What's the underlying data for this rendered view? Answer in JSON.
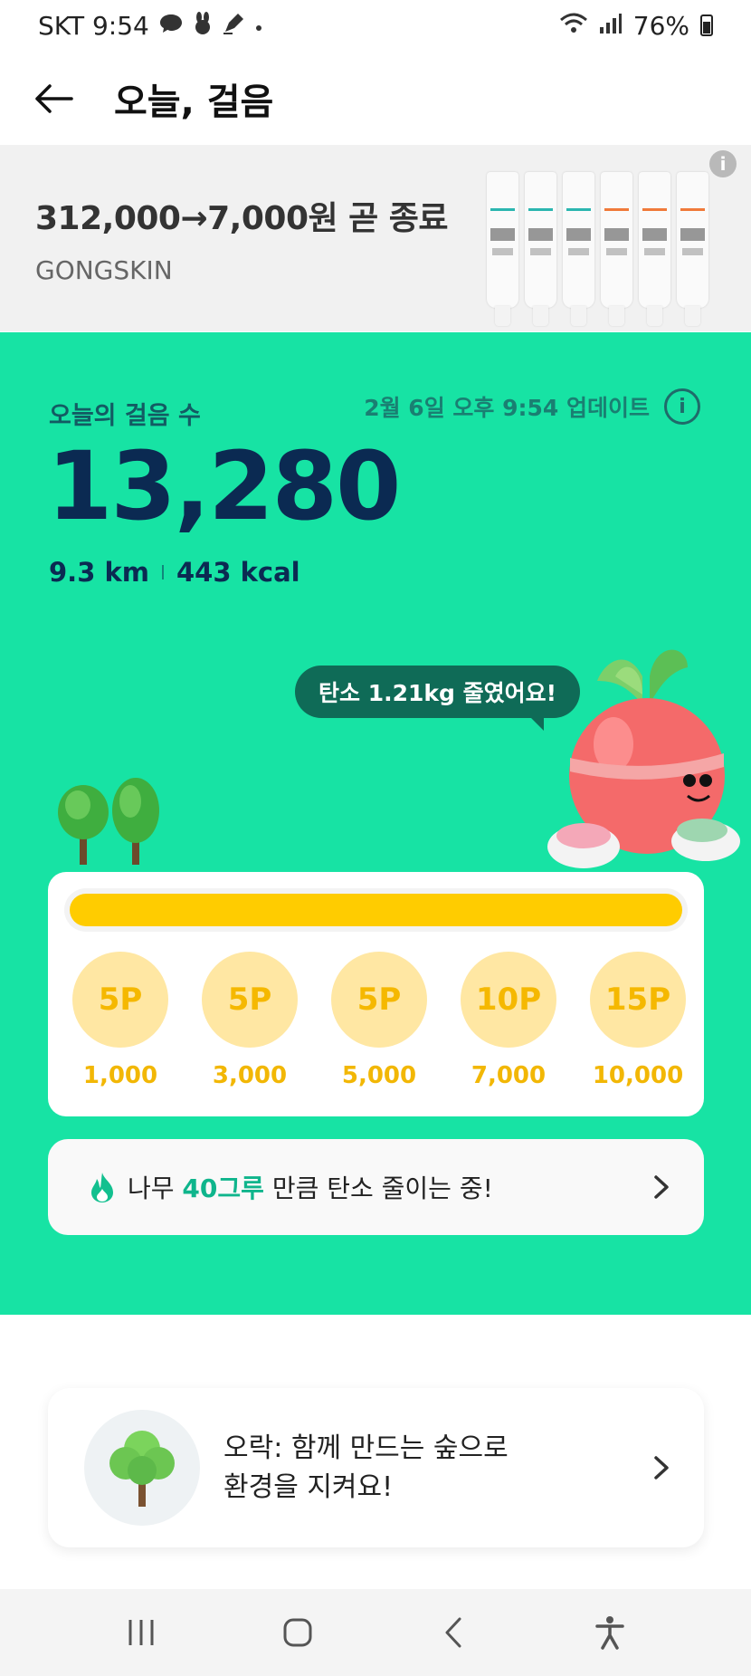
{
  "status_bar": {
    "carrier_time": "SKT 9:54",
    "battery": "76%",
    "icons": [
      "chat-icon",
      "rabbit-icon",
      "pen-icon",
      "dot-icon",
      "wifi-icon",
      "signal-icon",
      "battery-icon"
    ]
  },
  "app_bar": {
    "title": "오늘, 걸음",
    "back_icon": "arrow-left-icon"
  },
  "ad": {
    "title": "312,000→7,000원 곧 종료",
    "brand": "GONGSKIN",
    "info_icon": "info-icon"
  },
  "steps": {
    "label": "오늘의 걸음 수",
    "updated": "2월 6일 오후 9:54 업데이트",
    "value": "13,280",
    "distance": "9.3 km",
    "calories": "443 kcal"
  },
  "mascot": {
    "bubble": "탄소 1.21kg 줄였어요!"
  },
  "progress": {
    "fraction": 1.0,
    "milestones": [
      {
        "points": "5P",
        "steps": "1,000"
      },
      {
        "points": "5P",
        "steps": "3,000"
      },
      {
        "points": "5P",
        "steps": "5,000"
      },
      {
        "points": "10P",
        "steps": "7,000"
      },
      {
        "points": "15P",
        "steps": "10,000"
      }
    ]
  },
  "trees": {
    "prefix": "나무 ",
    "count": "40그루",
    "suffix": " 만큼 탄소 줄이는 중!"
  },
  "forest": {
    "line1": "오락: 함께 만드는 숲으로",
    "line2": "환경을 지켜요!"
  },
  "colors": {
    "green_bg": "#17e3a4",
    "dark_navy": "#0b2a52",
    "progress_yellow": "#ffcc00",
    "coin_bg": "#ffe7a3",
    "coin_text": "#f5b800",
    "tree_count": "#0fb58c"
  }
}
